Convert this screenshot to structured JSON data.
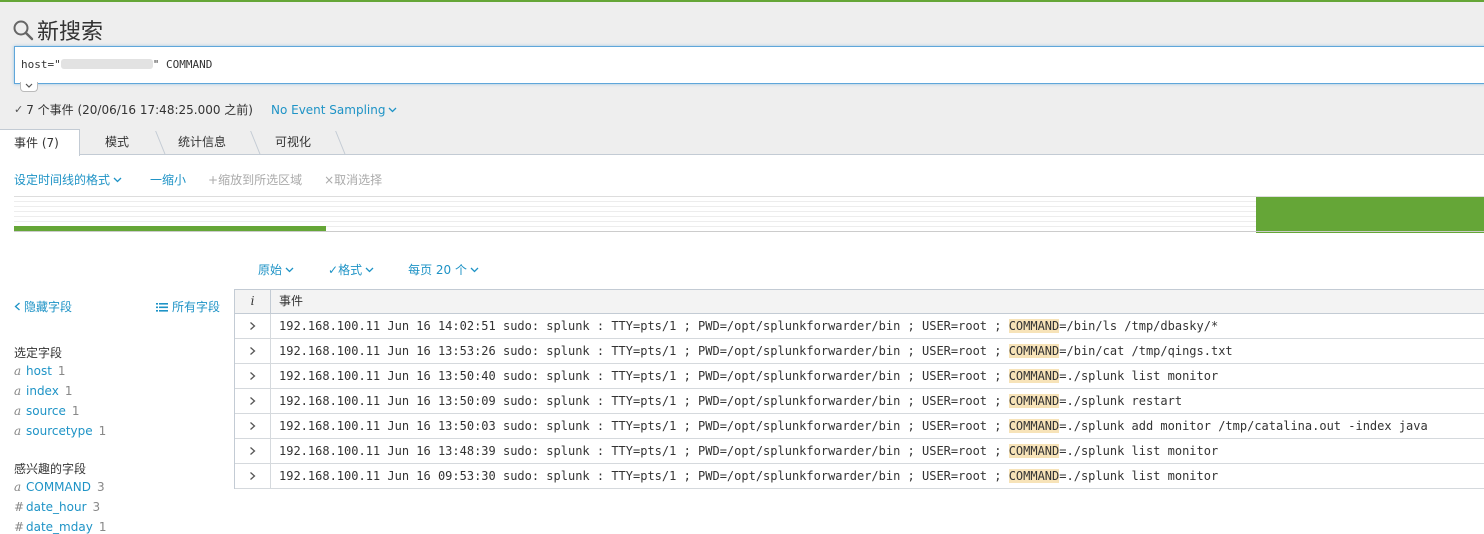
{
  "header": {
    "title": "新搜索",
    "search_query_prefix": "host=\"",
    "search_query_suffix": "\" COMMAND",
    "status_check": "✓",
    "status_text": "7 个事件 (20/06/16 17:48:25.000 之前)",
    "sampling_label": "No Event Sampling"
  },
  "tabs": [
    {
      "label": "事件 (7)"
    },
    {
      "label": "模式"
    },
    {
      "label": "统计信息"
    },
    {
      "label": "可视化"
    }
  ],
  "timeline": {
    "format_label": "设定时间线的格式",
    "zoom_out": "一缩小",
    "zoom_selection": "+缩放到所选区域",
    "deselect": "×取消选择",
    "histogram": [
      {
        "fraction": 0.17
      },
      {
        "fraction": 1.0
      }
    ]
  },
  "results_toolbar": {
    "raw_label": "原始",
    "format_label": "✓格式",
    "per_page_label": "每页 20 个"
  },
  "sidebar": {
    "hide_fields": "隐藏字段",
    "all_fields": "所有字段",
    "selected_title": "选定字段",
    "selected_fields": [
      {
        "type": "a",
        "name": "host",
        "count": "1"
      },
      {
        "type": "a",
        "name": "index",
        "count": "1"
      },
      {
        "type": "a",
        "name": "source",
        "count": "1"
      },
      {
        "type": "a",
        "name": "sourcetype",
        "count": "1"
      }
    ],
    "interesting_title": "感兴趣的字段",
    "interesting_fields": [
      {
        "type": "a",
        "name": "COMMAND",
        "count": "3"
      },
      {
        "type": "#",
        "name": "date_hour",
        "count": "3"
      },
      {
        "type": "#",
        "name": "date_mday",
        "count": "1"
      }
    ]
  },
  "table": {
    "col_info": "i",
    "col_event": "事件",
    "rows": [
      {
        "pre": "192.168.100.11 Jun 16 14:02:51 sudo: splunk : TTY=pts/1 ; PWD=/opt/splunkforwarder/bin ; USER=root ; ",
        "hl": "COMMAND",
        "post": "=/bin/ls /tmp/dbasky/*"
      },
      {
        "pre": "192.168.100.11 Jun 16 13:53:26 sudo: splunk : TTY=pts/1 ; PWD=/opt/splunkforwarder/bin ; USER=root ; ",
        "hl": "COMMAND",
        "post": "=/bin/cat /tmp/qings.txt"
      },
      {
        "pre": "192.168.100.11 Jun 16 13:50:40 sudo: splunk : TTY=pts/1 ; PWD=/opt/splunkforwarder/bin ; USER=root ; ",
        "hl": "COMMAND",
        "post": "=./splunk list monitor"
      },
      {
        "pre": "192.168.100.11 Jun 16 13:50:09 sudo: splunk : TTY=pts/1 ; PWD=/opt/splunkforwarder/bin ; USER=root ; ",
        "hl": "COMMAND",
        "post": "=./splunk restart"
      },
      {
        "pre": "192.168.100.11 Jun 16 13:50:03 sudo: splunk : TTY=pts/1 ; PWD=/opt/splunkforwarder/bin ; USER=root ; ",
        "hl": "COMMAND",
        "post": "=./splunk add monitor /tmp/catalina.out -index java"
      },
      {
        "pre": "192.168.100.11 Jun 16 13:48:39 sudo: splunk : TTY=pts/1 ; PWD=/opt/splunkforwarder/bin ; USER=root ; ",
        "hl": "COMMAND",
        "post": "=./splunk list monitor"
      },
      {
        "pre": "192.168.100.11 Jun 16 09:53:30 sudo: splunk : TTY=pts/1 ; PWD=/opt/splunkforwarder/bin ; USER=root ; ",
        "hl": "COMMAND",
        "post": "=./splunk list monitor"
      }
    ]
  },
  "colors": {
    "accent": "#1e93c6",
    "bar": "#65a637",
    "highlight": "#f7e3b8"
  }
}
